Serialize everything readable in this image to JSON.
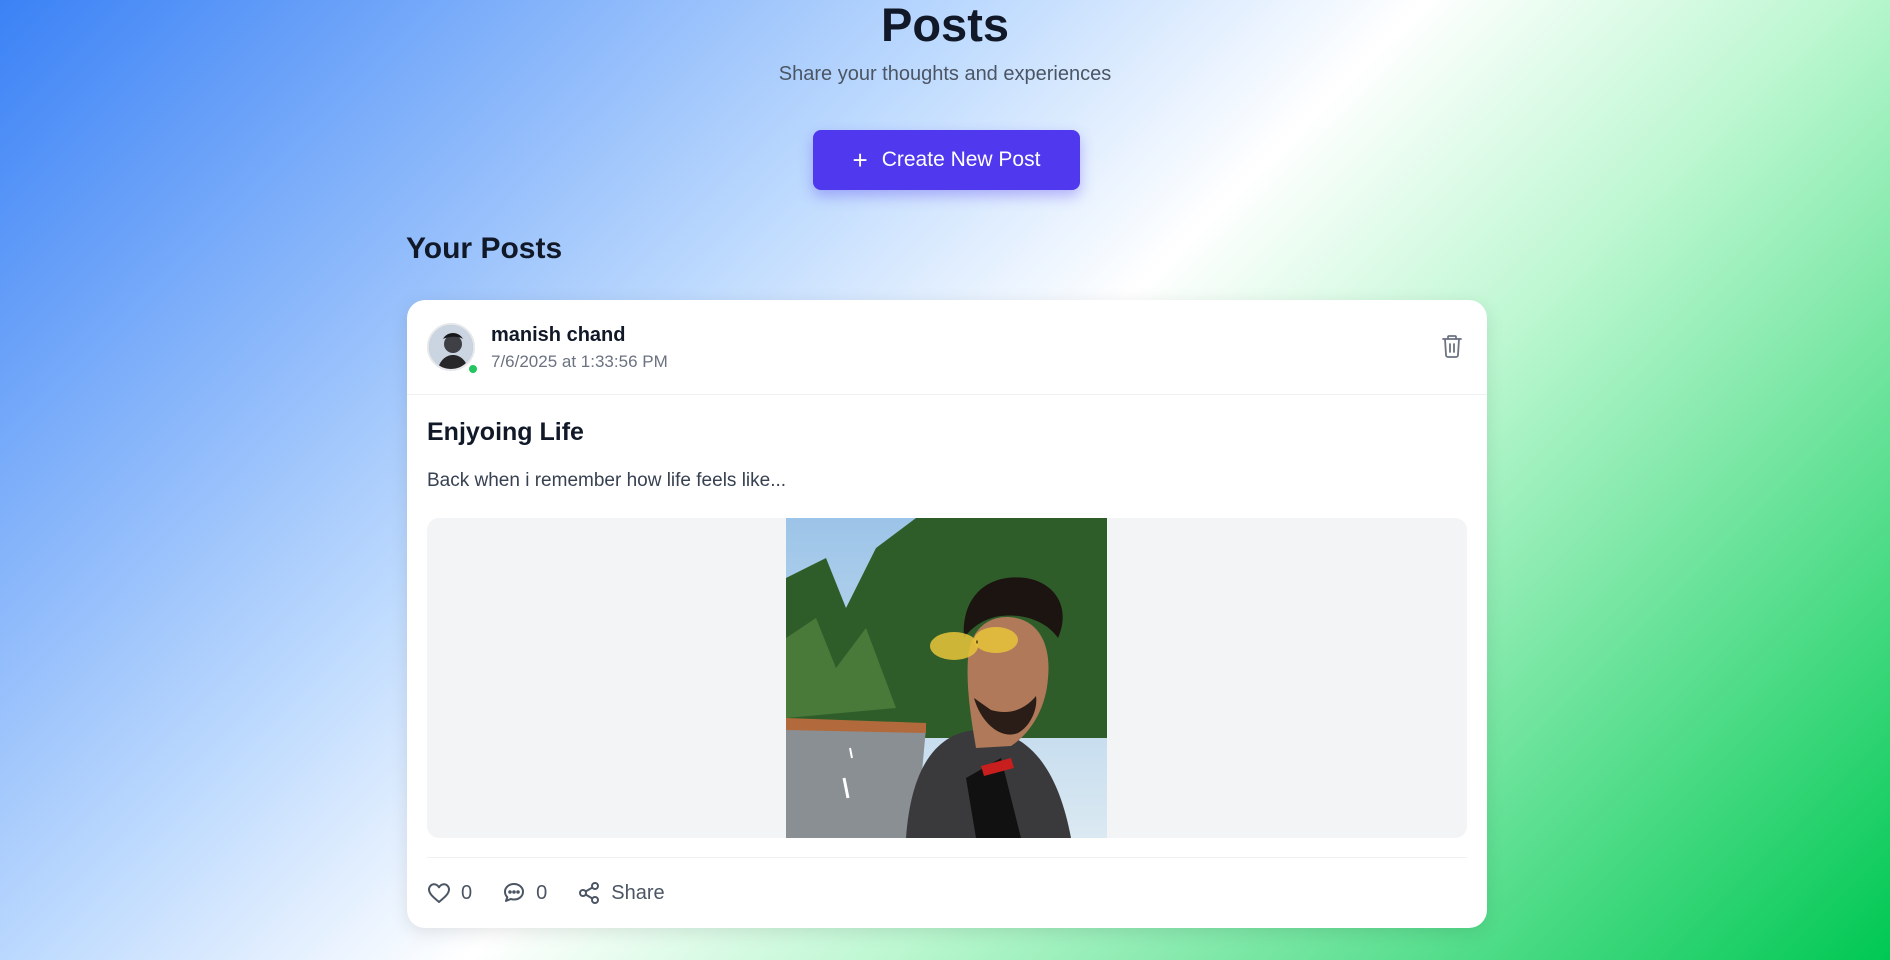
{
  "header": {
    "title": "Posts",
    "subtitle": "Share your thoughts and experiences",
    "create_button": "Create New Post",
    "create_icon": "plus-icon"
  },
  "section": {
    "title": "Your Posts"
  },
  "post": {
    "author": "manish chand",
    "timestamp": "7/6/2025 at 1:33:56 PM",
    "online": true,
    "title": "Enjyoing Life",
    "body": "Back when i remember how life feels like...",
    "likes": "0",
    "comments": "0",
    "share_label": "Share",
    "icons": {
      "delete": "trash-icon",
      "like": "heart-icon",
      "comment": "comment-icon",
      "share": "share-icon"
    }
  },
  "colors": {
    "accent": "#4f38ee",
    "online": "#22c55e",
    "muted": "#6b7280"
  }
}
